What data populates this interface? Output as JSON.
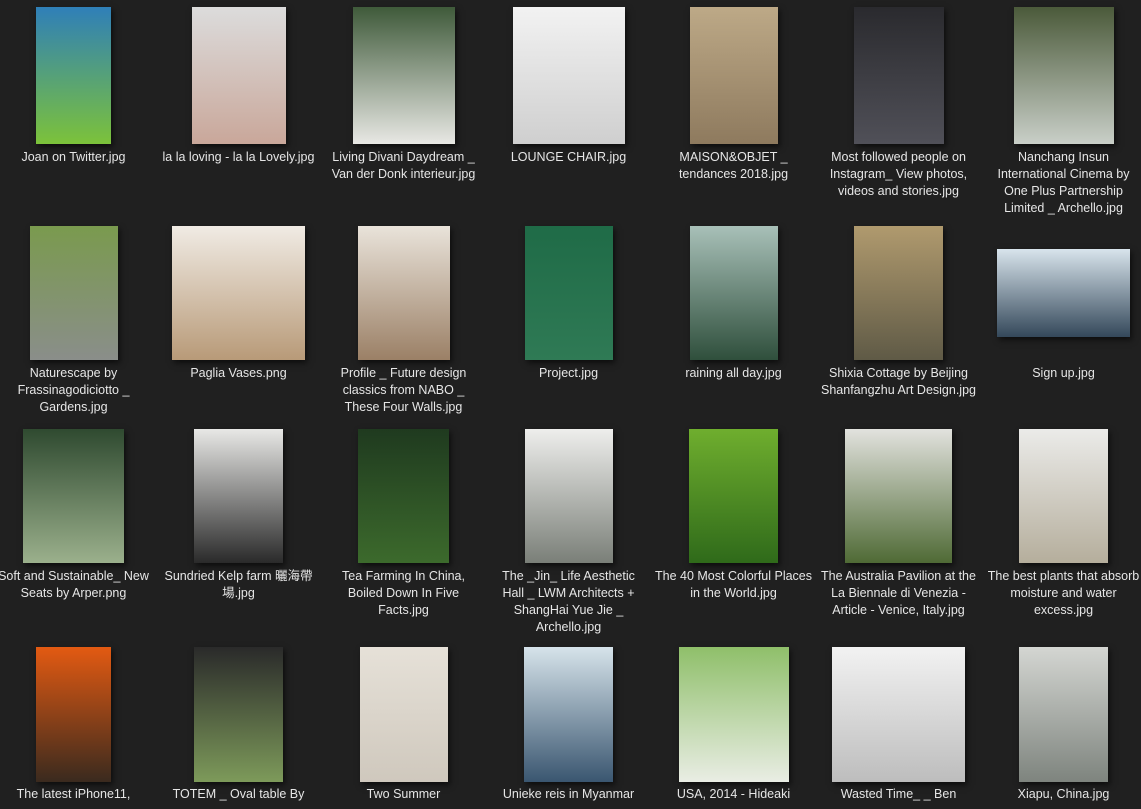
{
  "files": [
    {
      "name": "Joan on Twitter.jpg",
      "colors": [
        "#2f7fb8",
        "#7cc23a"
      ]
    },
    {
      "name": "la la loving - la la Lovely.jpg",
      "colors": [
        "#dcdcdc",
        "#c9a79a"
      ]
    },
    {
      "name": "Living Divani Daydream _ Van der Donk interieur.jpg",
      "colors": [
        "#3f5a3a",
        "#e8e8e4"
      ]
    },
    {
      "name": "LOUNGE CHAIR.jpg",
      "colors": [
        "#f2f2f2",
        "#cfcfcf"
      ]
    },
    {
      "name": "MAISON&OBJET _ tendances 2018.jpg",
      "colors": [
        "#bda987",
        "#8e7a5e"
      ]
    },
    {
      "name": "Most followed people on Instagram_ View photos, videos and stories.jpg",
      "colors": [
        "#2a2a2e",
        "#505058"
      ]
    },
    {
      "name": "Nanchang Insun International Cinema by One Plus Partnership Limited _ Archello.jpg",
      "colors": [
        "#4b5a3a",
        "#c9cfc8"
      ]
    },
    {
      "name": "Naturescape by Frassinagodiciotto _ Gardens.jpg",
      "colors": [
        "#7a9a4e",
        "#8a8e8a"
      ]
    },
    {
      "name": "Paglia Vases.png",
      "colors": [
        "#f0ebe4",
        "#b89a78"
      ]
    },
    {
      "name": "Profile _ Future design classics from NABO _ These Four Walls.jpg",
      "colors": [
        "#e9e3da",
        "#9b8066"
      ]
    },
    {
      "name": "Project.jpg",
      "colors": [
        "#1f6b47",
        "#2f7a55"
      ]
    },
    {
      "name": "raining all day.jpg",
      "colors": [
        "#a8c0b8",
        "#2f4f3c"
      ]
    },
    {
      "name": "Shixia Cottage by Beijing Shanfangzhu Art Design.jpg",
      "colors": [
        "#b09a6e",
        "#5f5a46"
      ]
    },
    {
      "name": "Sign up.jpg",
      "colors": [
        "#d8e4ec",
        "#34485a"
      ]
    },
    {
      "name": "Soft and Sustainable_ New Seats by Arper.png",
      "colors": [
        "#2f4a30",
        "#9bb08c"
      ]
    },
    {
      "name": "Sundried Kelp farm 曬海帶場.jpg",
      "colors": [
        "#e8e8e6",
        "#2a2a2a"
      ]
    },
    {
      "name": "Tea Farming In China, Boiled Down In Five Facts.jpg",
      "colors": [
        "#1f3a1f",
        "#3c6a2c"
      ]
    },
    {
      "name": "The _Jin_ Life Aesthetic Hall _ LWM Architects + ShangHai Yue Jie _ Archello.jpg",
      "colors": [
        "#eeeeec",
        "#7a7f78"
      ]
    },
    {
      "name": "The 40 Most Colorful Places in the World.jpg",
      "colors": [
        "#6fae2e",
        "#2f6a1a"
      ]
    },
    {
      "name": "The Australia Pavilion at the La Biennale di Venezia - Article - Venice, Italy.jpg",
      "colors": [
        "#e2e2de",
        "#4f6a35"
      ]
    },
    {
      "name": "The best plants that absorb moisture and water excess.jpg",
      "colors": [
        "#ebebe9",
        "#b5ae9c"
      ]
    },
    {
      "name": "The latest iPhone11,",
      "colors": [
        "#e35a12",
        "#3a2a1e"
      ]
    },
    {
      "name": "TOTEM _ Oval table By",
      "colors": [
        "#2a2a2a",
        "#7d9a5a"
      ]
    },
    {
      "name": "Two Summer",
      "colors": [
        "#e6e1d8",
        "#cfc8bd"
      ]
    },
    {
      "name": "Unieke reis in Myanmar",
      "colors": [
        "#d6e3ea",
        "#3a5670"
      ]
    },
    {
      "name": "USA, 2014 - Hideaki",
      "colors": [
        "#8fbf6a",
        "#e9ede4"
      ]
    },
    {
      "name": "Wasted Time_ _ Ben",
      "colors": [
        "#f2f2f2",
        "#bdbdbd"
      ]
    },
    {
      "name": "Xiapu, China.jpg",
      "colors": [
        "#d4d6d2",
        "#7e847e"
      ]
    }
  ]
}
